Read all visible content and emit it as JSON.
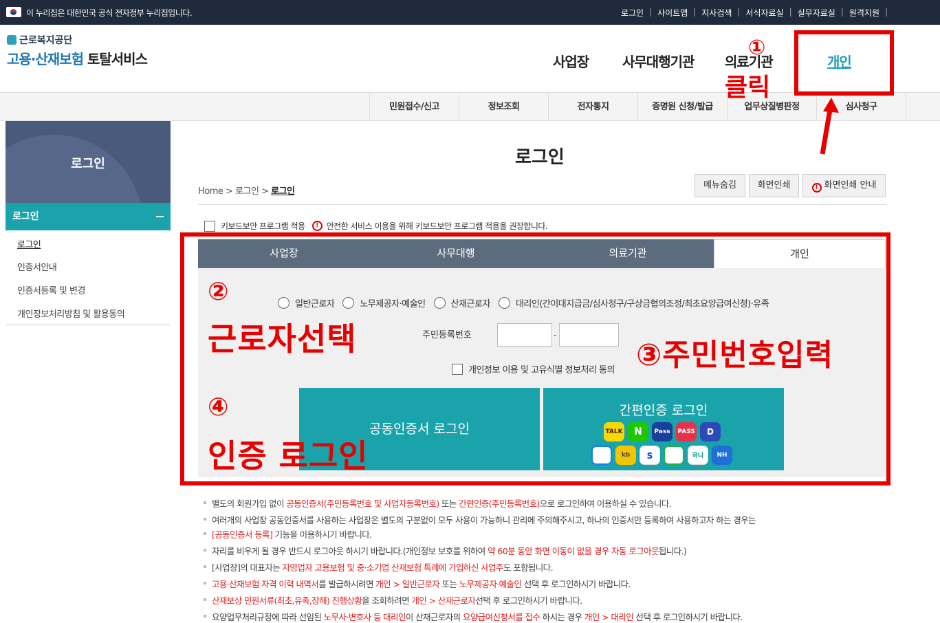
{
  "gov_banner": {
    "message": "이 누리집은 대한민국 공식 전자정부 누리집입니다.",
    "util_links": [
      "로그인",
      "사이트맵",
      "지사검색",
      "서식자료실",
      "실무자료실",
      "원격지원"
    ]
  },
  "logo": {
    "org": "근로복지공단",
    "title_blue": "고용·산재보험",
    "title_dark": "토탈서비스"
  },
  "gnb": [
    "사업장",
    "사무대행기관",
    "의료기관",
    "개인"
  ],
  "snb": [
    "민원접수/신고",
    "정보조회",
    "전자통지",
    "증명원 신청/발급",
    "업무상질병판정",
    "심사청구"
  ],
  "lnb": {
    "title": "로그인",
    "current": "로그인",
    "items": [
      "로그인",
      "인증서안내",
      "인증서등록 및 변경",
      "개인정보처리방침 및 활용동의"
    ]
  },
  "page": {
    "title": "로그인",
    "breadcrumb": [
      "Home",
      "로그인",
      "로그인"
    ],
    "tools": [
      "메뉴숨김",
      "화면인쇄",
      "화면인쇄 안내"
    ]
  },
  "keyboard": {
    "label": "키보드보안 프로그램 적용",
    "notice": "안전한 서비스 이용을 위해 키보드보안 프로그램 적용을 권장합니다."
  },
  "tabs": [
    "사업장",
    "사무대행",
    "의료기관",
    "개인"
  ],
  "worker_types": [
    "일반근로자",
    "노무제공자·예술인",
    "산재근로자",
    "대리인(간이대지급금/심사청구/구상금협의조정/최초요양급여신청)·유족"
  ],
  "rrn_label": "주민등록번호",
  "agree_label": "개인정보 이용 및 고유식별 정보처리 동의",
  "cert_login": "공동인증서 로그인",
  "simple_login": {
    "label": "간편인증 로그인",
    "providers": [
      "kakao-icon",
      "naver-icon",
      "samsung-pass-icon",
      "pass-icon",
      "d-icon",
      "toss-icon",
      "kb-icon",
      "shinhan-icon",
      "payco-icon",
      "hana-icon",
      "nh-icon"
    ],
    "icon_text": [
      "TALK",
      "N",
      "Pass",
      "PASS",
      "D",
      "",
      "kb",
      "S",
      "",
      "하나",
      "NH"
    ]
  },
  "annotations": {
    "step1": "①",
    "click": "클릭",
    "step2": "②",
    "worker_select": "근로자선택",
    "step3": "③주민번호입력",
    "step4": "④",
    "cert_login": "인증 로그인"
  },
  "notes": [
    [
      "별도의 회원가입 없이 ",
      "공동인증서(주민등록번호 및 사업자등록번호)",
      " 또는 ",
      "간편인증(주민등록번호)",
      "으로 로그인하여 이용하실 수 있습니다."
    ],
    [
      "여러개의 사업장 공동인증서를 사용하는 사업장은 별도의 구분없이 모두 사용이 가능하니 관리에 주의해주시고, 하나의 인증서만 등록하여 사용하고자 하는 경우는"
    ],
    [
      "",
      "[공동인증서 등록]",
      " 기능을 이용하시기 바랍니다."
    ],
    [
      "자리를 비우게 될 경우 반드시 로그아웃 하시기 바랍니다.(개인정보 보호를 위하여 ",
      "약 60분 동안 화면 이동이 없을 경우 자동 로그아웃",
      "됩니다.)"
    ],
    [
      "[사업장]의 대표자는 ",
      "자영업자 고용보험 및 중·소기업 산재보험 특례에 가입하신 사업주",
      "도 포함됩니다."
    ],
    [
      "",
      "고용·산재보험 자격 이력 내역서",
      "를 발급하시려면 ",
      "개인 > 일반근로자",
      " 또는 ",
      "노무제공자·예술인",
      " 선택 후 로그인하시기 바랍니다."
    ],
    [
      "",
      "산재보상 민원서류(최초,유족,장해) 진행상황",
      "을 조회하려면 ",
      "개인 > 산재근로자",
      "선택 후 로그인하시기 바랍니다."
    ],
    [
      "요양업무처리규정에 따라 선임된 ",
      "노무사·변호사 등 대리인",
      "이 산재근로자의 ",
      "요양급여신청서를 접수",
      " 하시는 경우 ",
      "개인 > 대리인",
      " 선택 후 로그인하시기 바랍니다."
    ]
  ]
}
